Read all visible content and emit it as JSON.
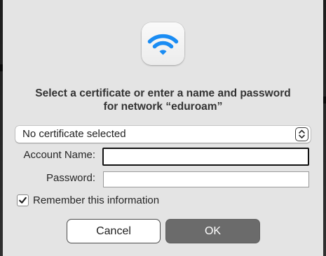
{
  "dialog": {
    "prompt_line1": "Select a certificate or enter a name and password",
    "prompt_line2": "for network “eduroam”",
    "icon": "wifi-icon",
    "accent_color": "#1a8cf3"
  },
  "certificate_select": {
    "selected": "No certificate selected",
    "icon": "up-down-chevron-icon"
  },
  "account": {
    "label": "Account Name:",
    "value": "",
    "placeholder": ""
  },
  "password": {
    "label": "Password:",
    "value": "",
    "placeholder": ""
  },
  "remember": {
    "label": "Remember this information",
    "checked": true
  },
  "buttons": {
    "cancel_label": "Cancel",
    "ok_label": "OK"
  }
}
